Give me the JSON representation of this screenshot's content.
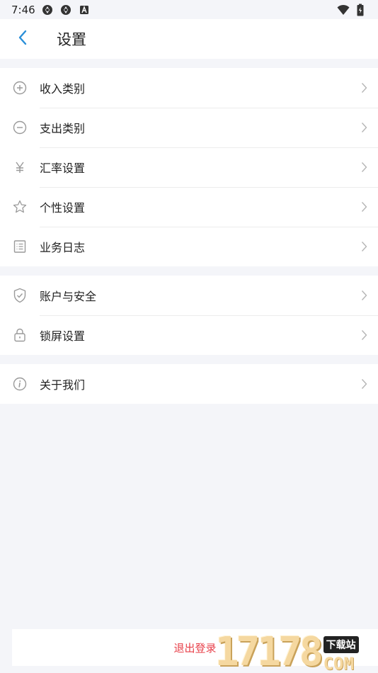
{
  "status_bar": {
    "time": "7:46",
    "icons": [
      "aperture-icon",
      "aperture-icon",
      "a-badge-icon"
    ],
    "right_icons": [
      "wifi-icon",
      "battery-icon"
    ]
  },
  "header": {
    "title": "设置",
    "back_icon": "chevron-left-icon"
  },
  "groups": [
    {
      "items": [
        {
          "label": "收入类别",
          "icon": "plus-circle-icon"
        },
        {
          "label": "支出类别",
          "icon": "minus-circle-icon"
        },
        {
          "label": "汇率设置",
          "icon": "yen-icon"
        },
        {
          "label": "个性设置",
          "icon": "star-icon"
        },
        {
          "label": "业务日志",
          "icon": "list-icon"
        }
      ]
    },
    {
      "items": [
        {
          "label": "账户与安全",
          "icon": "shield-check-icon"
        },
        {
          "label": "锁屏设置",
          "icon": "lock-icon"
        }
      ]
    },
    {
      "items": [
        {
          "label": "关于我们",
          "icon": "info-circle-icon"
        }
      ]
    }
  ],
  "logout": {
    "label": "退出登录",
    "color": "#e8404a"
  },
  "watermark": {
    "number": "17178",
    "tag": "下载站",
    "suffix": "COM"
  },
  "colors": {
    "accent": "#2a8fd8",
    "background": "#f4f5f9",
    "icon_gray": "#9a9a9a"
  }
}
